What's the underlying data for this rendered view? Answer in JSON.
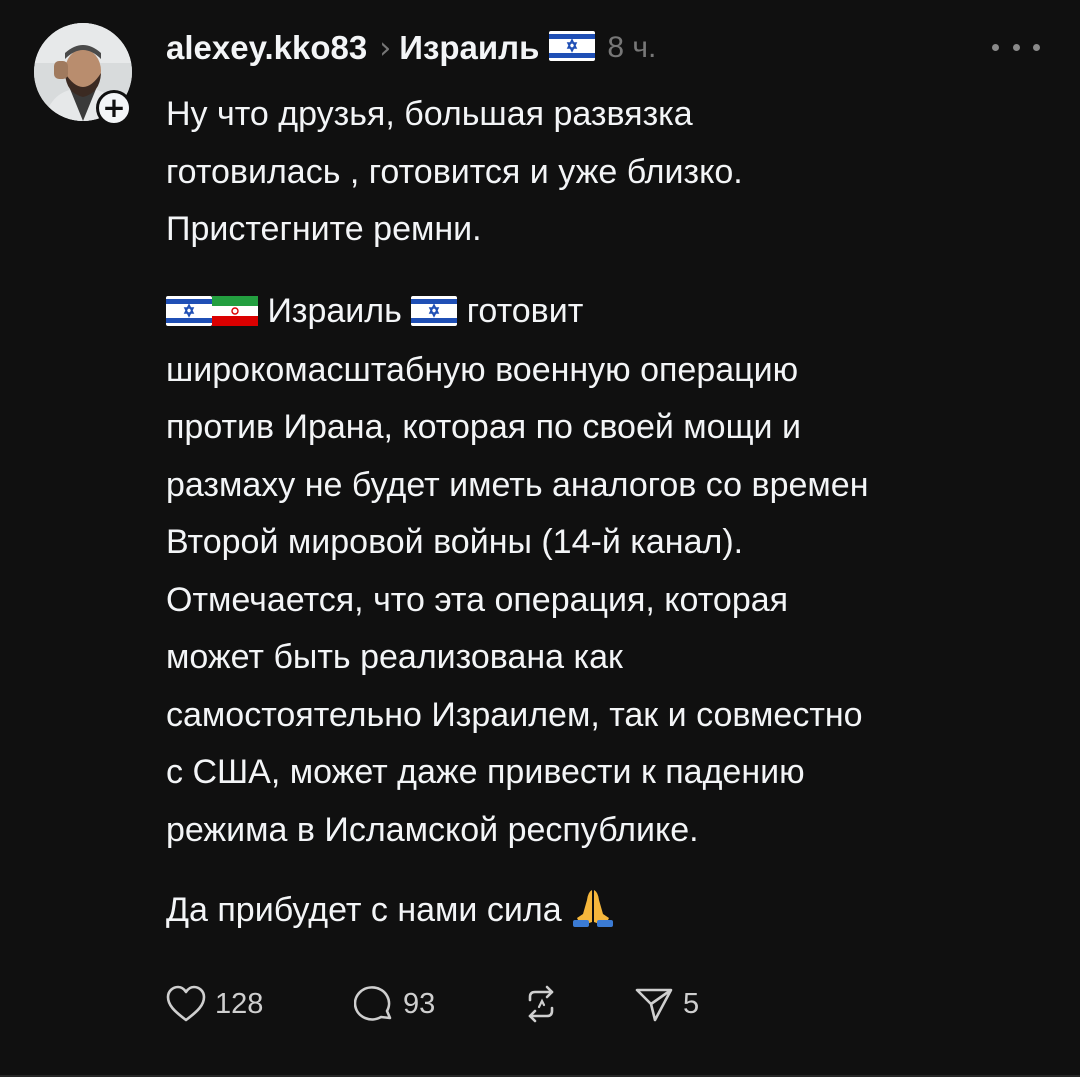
{
  "post": {
    "username": "alexey.kko83",
    "topic": "Израиль",
    "time": "8 ч.",
    "paragraph1": [
      "Ну что друзья, большая развязка",
      "готовилась , готовится и уже близко.",
      "Пристегните ремни."
    ],
    "paragraph2_first": {
      "part1": "Израиль",
      "part2": "готовит"
    },
    "paragraph2_rest": [
      "широкомасштабную военную операцию",
      "против Ирана, которая по своей мощи и",
      "размаху не будет иметь аналогов со времен",
      "Второй мировой войны (14-й канал).",
      "Отмечается, что эта операция, которая",
      "может быть реализована как",
      "самостоятельно Израилем, так и совместно",
      "с США,  может даже привести к падению",
      "режима в Исламской республике."
    ],
    "paragraph3": "Да прибудет с нами сила"
  },
  "actions": {
    "likes": "128",
    "comments": "93",
    "shares": "5"
  },
  "icons": {
    "avatar": "user-avatar",
    "follow": "plus-icon",
    "flags": [
      "israel-flag-icon",
      "iran-flag-icon"
    ],
    "emoji": "praying-hands-icon",
    "like": "heart-icon",
    "comment": "comment-bubble-icon",
    "repost": "repost-icon",
    "share": "send-icon",
    "more": "more-options-icon"
  },
  "colors": {
    "background": "#101010",
    "text": "#f3f5f7",
    "muted": "#777777",
    "israel_blue": "#1f4fb5",
    "iran_green": "#239f40",
    "iran_red": "#da0000"
  }
}
